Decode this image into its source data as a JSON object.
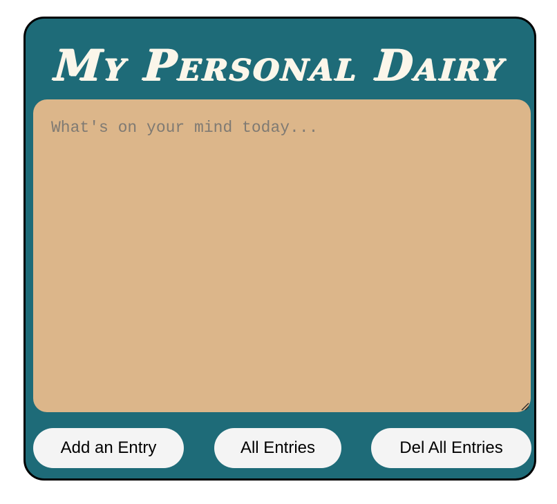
{
  "header": {
    "title": "My Personal Dairy"
  },
  "entry": {
    "placeholder": "What's on your mind today...",
    "value": ""
  },
  "actions": {
    "add_label": "Add an Entry",
    "all_label": "All Entries",
    "delete_all_label": "Del All Entries"
  },
  "colors": {
    "page_background": "#ffffff",
    "panel_background": "#1e6b78",
    "panel_border": "#000000",
    "title_text": "#fbf6ea",
    "textarea_background": "#dcb68a",
    "placeholder_text": "#7f7a73",
    "button_background": "#f4f4f4",
    "button_text": "#000000"
  },
  "icons": {
    "textarea_corner": "resize-grip-icon"
  }
}
